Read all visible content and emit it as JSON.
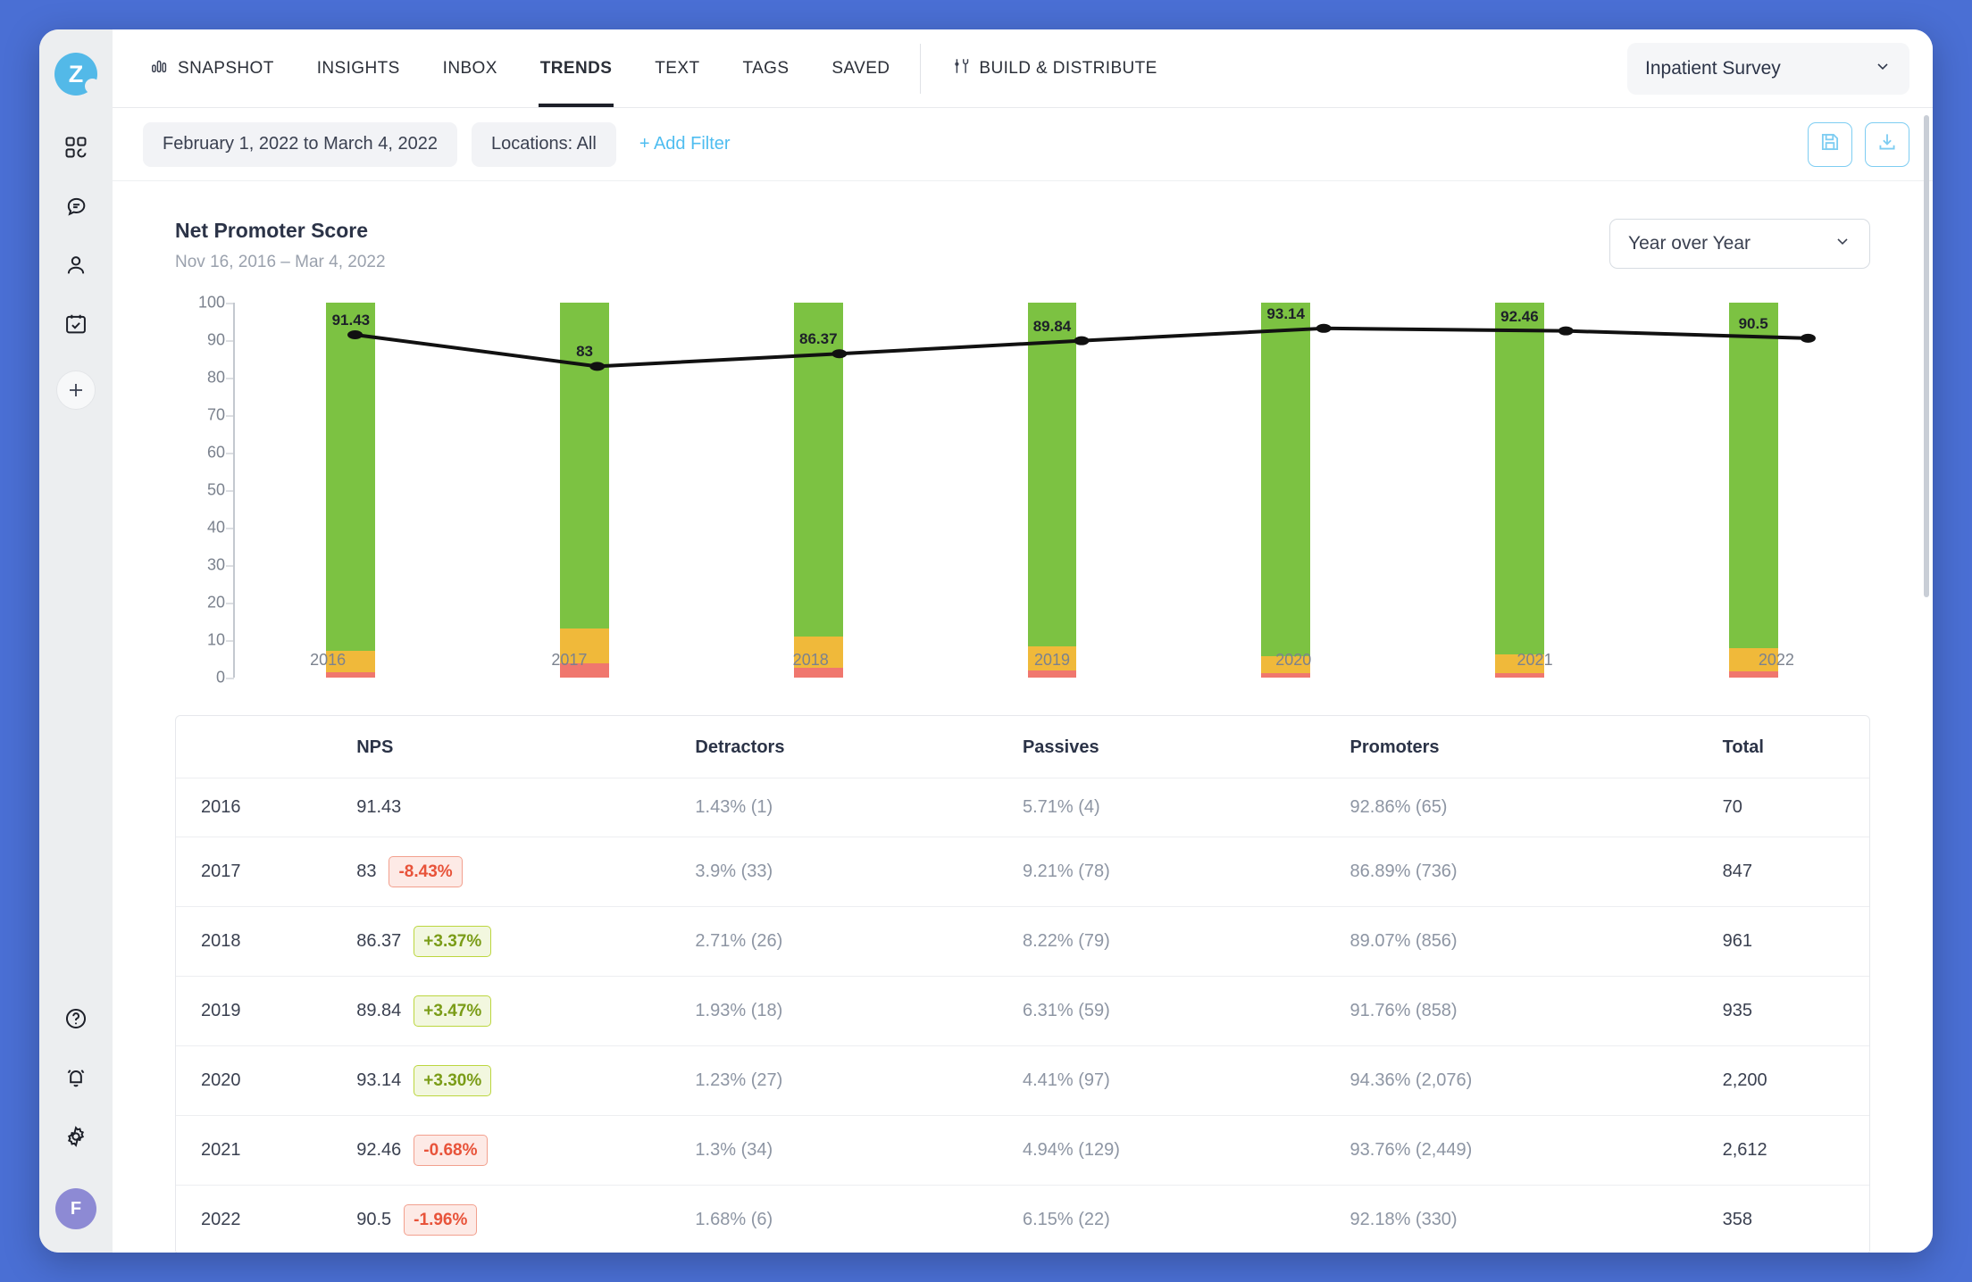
{
  "brand": {
    "logo_letter": "Z",
    "logo_color": "#53b9e8"
  },
  "sidebar": {
    "items": [
      {
        "name": "dashboard-icon",
        "label": "Dashboard"
      },
      {
        "name": "conversations-icon",
        "label": "Conversations"
      },
      {
        "name": "contacts-icon",
        "label": "Contacts"
      },
      {
        "name": "schedule-icon",
        "label": "Schedule"
      }
    ],
    "add_label": "+",
    "bottom": [
      {
        "name": "help-icon",
        "label": "Help"
      },
      {
        "name": "notifications-icon",
        "label": "Notifications"
      },
      {
        "name": "settings-icon",
        "label": "Settings"
      }
    ],
    "avatar_initial": "F",
    "avatar_color": "#8d8ad4"
  },
  "topnav": {
    "items": [
      {
        "label": "SNAPSHOT",
        "icon": "bar-chart-icon",
        "active": false
      },
      {
        "label": "INSIGHTS",
        "icon": "",
        "active": false
      },
      {
        "label": "INBOX",
        "icon": "",
        "active": false
      },
      {
        "label": "TRENDS",
        "icon": "",
        "active": true
      },
      {
        "label": "TEXT",
        "icon": "",
        "active": false
      },
      {
        "label": "TAGS",
        "icon": "",
        "active": false
      },
      {
        "label": "SAVED",
        "icon": "",
        "active": false
      }
    ],
    "build_distribute": {
      "label": "BUILD & DISTRIBUTE",
      "icon": "tools-icon"
    },
    "survey_selector": {
      "value": "Inpatient Survey"
    }
  },
  "filterbar": {
    "date_range": "February 1, 2022 to March 4, 2022",
    "locations": "Locations: All",
    "add_filter": "+ Add Filter",
    "save_button": "save-icon",
    "download_button": "download-icon",
    "accent_color": "#4fbdf0"
  },
  "card": {
    "title": "Net Promoter Score",
    "subtitle": "Nov 16, 2016 – Mar 4, 2022",
    "grouping": {
      "value": "Year over Year"
    }
  },
  "chart_data": {
    "type": "bar",
    "title": "Net Promoter Score",
    "subtitle": "Nov 16, 2016 – Mar 4, 2022",
    "xlabel": "",
    "ylabel": "",
    "ylim": [
      0,
      100
    ],
    "yticks": [
      0,
      10,
      20,
      30,
      40,
      50,
      60,
      70,
      80,
      90,
      100
    ],
    "grid": false,
    "legend": "none",
    "stacked": true,
    "categories": [
      "2016",
      "2017",
      "2018",
      "2019",
      "2020",
      "2021",
      "2022"
    ],
    "series": [
      {
        "name": "Detractors",
        "color": "#f0776e",
        "values": [
          1.43,
          3.9,
          2.71,
          1.93,
          1.23,
          1.3,
          1.68
        ]
      },
      {
        "name": "Passives",
        "color": "#f0b93a",
        "values": [
          5.71,
          9.21,
          8.22,
          6.31,
          4.41,
          4.94,
          6.15
        ]
      },
      {
        "name": "Promoters",
        "color": "#7cc242",
        "values": [
          92.86,
          86.89,
          89.07,
          91.76,
          94.36,
          93.76,
          92.18
        ]
      }
    ],
    "line_series": {
      "name": "NPS",
      "color": "#111111",
      "values": [
        91.43,
        83,
        86.37,
        89.84,
        93.14,
        92.46,
        90.5
      ],
      "labels": [
        "91.43",
        "83",
        "86.37",
        "89.84",
        "93.14",
        "92.46",
        "90.5"
      ]
    }
  },
  "table": {
    "columns": [
      "",
      "NPS",
      "Detractors",
      "Passives",
      "Promoters",
      "Total"
    ],
    "rows": [
      {
        "year": "2016",
        "nps": "91.43",
        "delta": "",
        "delta_dir": "",
        "detractors": "1.43% (1)",
        "passives": "5.71% (4)",
        "promoters": "92.86% (65)",
        "total": "70"
      },
      {
        "year": "2017",
        "nps": "83",
        "delta": "-8.43%",
        "delta_dir": "down",
        "detractors": "3.9% (33)",
        "passives": "9.21% (78)",
        "promoters": "86.89% (736)",
        "total": "847"
      },
      {
        "year": "2018",
        "nps": "86.37",
        "delta": "+3.37%",
        "delta_dir": "up",
        "detractors": "2.71% (26)",
        "passives": "8.22% (79)",
        "promoters": "89.07% (856)",
        "total": "961"
      },
      {
        "year": "2019",
        "nps": "89.84",
        "delta": "+3.47%",
        "delta_dir": "up",
        "detractors": "1.93% (18)",
        "passives": "6.31% (59)",
        "promoters": "91.76% (858)",
        "total": "935"
      },
      {
        "year": "2020",
        "nps": "93.14",
        "delta": "+3.30%",
        "delta_dir": "up",
        "detractors": "1.23% (27)",
        "passives": "4.41% (97)",
        "promoters": "94.36% (2,076)",
        "total": "2,200"
      },
      {
        "year": "2021",
        "nps": "92.46",
        "delta": "-0.68%",
        "delta_dir": "down",
        "detractors": "1.3% (34)",
        "passives": "4.94% (129)",
        "promoters": "93.76% (2,449)",
        "total": "2,612"
      },
      {
        "year": "2022",
        "nps": "90.5",
        "delta": "-1.96%",
        "delta_dir": "down",
        "detractors": "1.68% (6)",
        "passives": "6.15% (22)",
        "promoters": "92.18% (330)",
        "total": "358"
      }
    ]
  }
}
